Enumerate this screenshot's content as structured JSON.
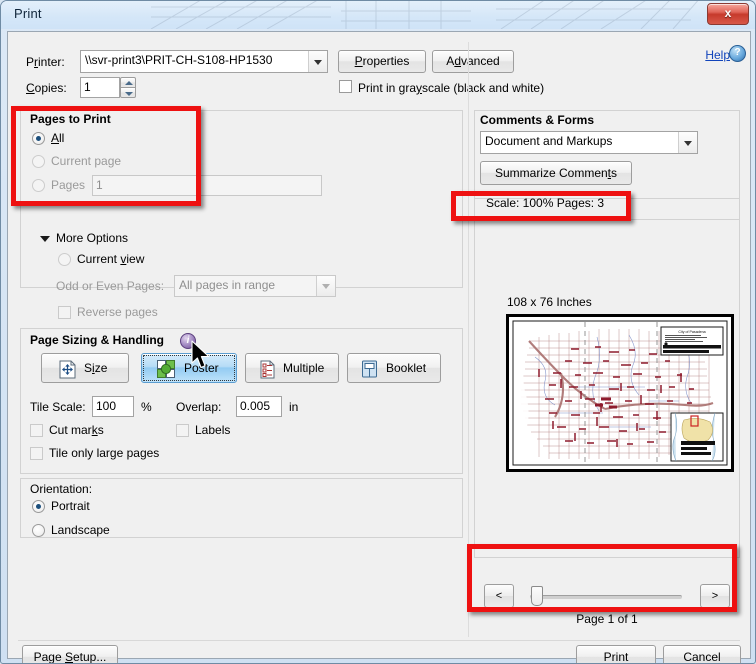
{
  "window": {
    "title": "Print",
    "close_label": "x"
  },
  "help": {
    "label": "Help",
    "icon": "question-mark-icon"
  },
  "printer": {
    "label": "Printer:",
    "value": "\\\\svr-print3\\PRIT-CH-S108-HP1530",
    "properties_label": "Properties",
    "advanced_label": "Advanced",
    "copies_label": "Copies:",
    "copies_value": "1",
    "grayscale_label": "Print in grayscale (black and white)",
    "grayscale_checked": false
  },
  "pages_to_print": {
    "header": "Pages to Print",
    "options": [
      {
        "label": "All",
        "selected": true,
        "disabled": false
      },
      {
        "label": "Current page",
        "selected": false,
        "disabled": true
      },
      {
        "label": "Pages",
        "selected": false,
        "disabled": true
      }
    ],
    "pages_value": "1"
  },
  "more_options": {
    "header": "More Options",
    "expanded": true,
    "current_view_label": "Current view",
    "current_view_selected": false,
    "odd_even_label": "Odd or Even Pages:",
    "odd_even_value": "All pages in range",
    "reverse_label": "Reverse pages",
    "reverse_checked": false
  },
  "page_sizing": {
    "header": "Page Sizing & Handling",
    "info_icon": "info-icon",
    "buttons": [
      {
        "label": "Size",
        "selected": false,
        "icon": "fit-size-icon"
      },
      {
        "label": "Poster",
        "selected": true,
        "icon": "poster-tiles-icon"
      },
      {
        "label": "Multiple",
        "selected": false,
        "icon": "multiple-pages-icon"
      },
      {
        "label": "Booklet",
        "selected": false,
        "icon": "booklet-icon"
      }
    ],
    "tile_scale_label": "Tile Scale:",
    "tile_scale_value": "100",
    "tile_scale_unit": "%",
    "overlap_label": "Overlap:",
    "overlap_value": "0.005",
    "overlap_unit": "in",
    "cut_marks_label": "Cut marks",
    "cut_marks_checked": false,
    "labels_label": "Labels",
    "labels_checked": false,
    "tile_only_label": "Tile only large pages",
    "tile_only_checked": false
  },
  "orientation": {
    "header": "Orientation:",
    "options": [
      {
        "label": "Portrait",
        "selected": true
      },
      {
        "label": "Landscape",
        "selected": false
      }
    ]
  },
  "comments_forms": {
    "header": "Comments & Forms",
    "value": "Document and Markups",
    "summarize_label": "Summarize Comments"
  },
  "scale_status": {
    "text": "Scale: 100% Pages: 3"
  },
  "preview": {
    "size_label": "108 x 76 Inches",
    "document_title": "City of Pasadena"
  },
  "page_nav": {
    "prev_label": "<",
    "next_label": ">",
    "page_of": "Page 1 of 1"
  },
  "footer": {
    "page_setup_label": "Page Setup...",
    "print_label": "Print",
    "cancel_label": "Cancel"
  },
  "annotations": {
    "highlight_color": "#ee1111",
    "boxes": [
      "pages-to-print-highlight",
      "scale-status-highlight",
      "page-nav-highlight"
    ]
  }
}
